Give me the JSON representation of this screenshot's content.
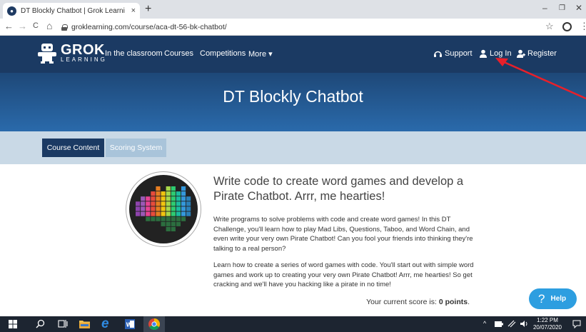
{
  "browser": {
    "tab_title": "DT Blockly Chatbot | Grok Learni",
    "tab_close": "×",
    "new_tab": "+",
    "back": "←",
    "forward": "→",
    "reload": "C",
    "home": "⌂",
    "url": "groklearning.com/course/aca-dt-56-bk-chatbot/",
    "star": "☆",
    "menu": "⋮",
    "minimize": "–",
    "maximize": "❐",
    "close": "✕"
  },
  "site": {
    "logo_main": "GROK",
    "logo_sub": "LEARNING",
    "nav": {
      "classroom": "In the classroom",
      "courses": "Courses",
      "competitions": "Competitions",
      "more": "More ▾",
      "support": "Support",
      "login": "Log In",
      "register": "Register"
    },
    "hero_title": "DT Blockly Chatbot"
  },
  "tabs": {
    "course_content": "Course Content",
    "scoring_system": "Scoring System"
  },
  "content": {
    "headline": "Write code to create word games and develop a Pirate Chatbot. Arrr, me hearties!",
    "para1": "Write programs to solve problems with code and create word games! In this DT Challenge, you'll learn how to play Mad Libs, Questions, Taboo, and Word Chain, and even write your very own Pirate Chatbot! Can you fool your friends into thinking they're talking to a real person?",
    "para2": "Learn how to create a series of word games with code. You'll start out with simple word games and work up to creating your very own Pirate Chatbot! Arrr, me hearties! So get cracking and we'll have you hacking like a pirate in no time!",
    "score_prefix": "Your current score is: ",
    "score_value": "0 points",
    "score_suffix": ".",
    "help": "Help",
    "help_glyph": "?"
  },
  "taskbar": {
    "time": "1:22 PM",
    "date": "20/07/2020"
  },
  "colors": {
    "nav_bg": "#1b3a63",
    "hero_top": "#1e4878",
    "hero_bottom": "#2a6aab",
    "band": "#c9d9e6",
    "help": "#2d9ee0",
    "annotation_arrow": "#e8202a"
  }
}
